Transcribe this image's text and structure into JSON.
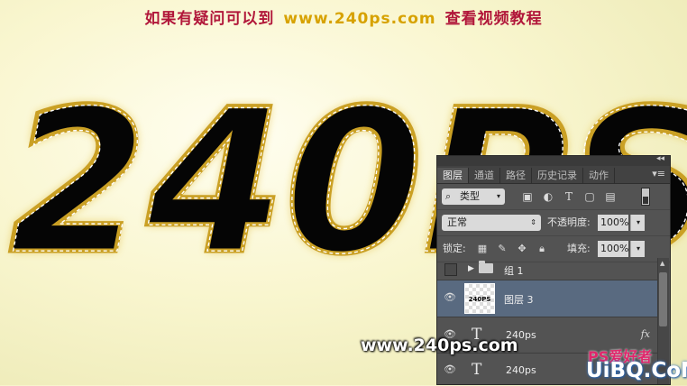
{
  "banner": {
    "prefix": "如果有疑问可以到",
    "url": "www.240ps.com",
    "suffix": "查看视频教程"
  },
  "canvas": {
    "big_text": "240PS"
  },
  "panel": {
    "collapse_label": "◂◂",
    "menu_label": "▾≡",
    "tabs": [
      "图层",
      "通道",
      "路径",
      "历史记录",
      "动作"
    ],
    "active_tab": 0,
    "filter": {
      "label": "类型",
      "icon": "search-icon"
    },
    "filter_icons": [
      "image-filter-icon",
      "adjustment-filter-icon",
      "text-filter-icon",
      "shape-filter-icon",
      "smart-object-filter-icon"
    ],
    "blend_mode": "正常",
    "opacity_label": "不透明度:",
    "opacity_value": "100%",
    "lock_label": "锁定:",
    "lock_icons": [
      "lock-transparent-icon",
      "lock-image-icon",
      "lock-position-icon",
      "lock-all-icon"
    ],
    "fill_label": "填充:",
    "fill_value": "100%",
    "layers": [
      {
        "name": "组 1",
        "kind": "group",
        "visible": false
      },
      {
        "name": "图层 3",
        "kind": "pixel",
        "visible": true,
        "selected": true,
        "thumb_text": "240PS"
      },
      {
        "name": "240ps",
        "kind": "text",
        "visible": true,
        "fx": "fx"
      },
      {
        "name": "240ps",
        "kind": "text",
        "visible": true
      }
    ]
  },
  "watermarks": {
    "bottom_url": "www.240ps.com",
    "logo_text": "PS爱好者",
    "uibq": "UiBQ.CoM"
  }
}
